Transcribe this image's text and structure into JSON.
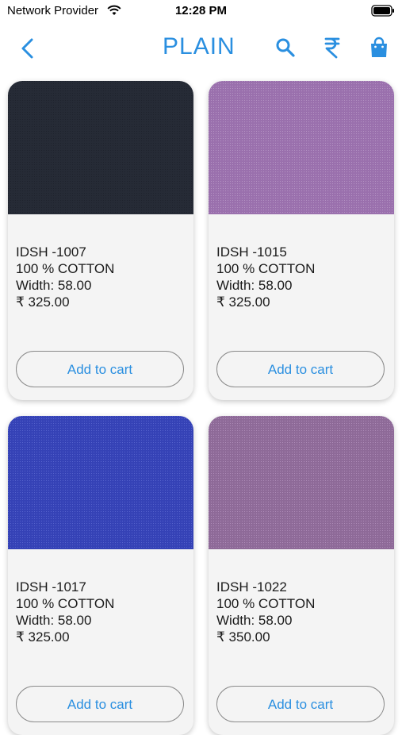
{
  "status_bar": {
    "carrier": "Network Provider",
    "time": "12:28 PM"
  },
  "nav": {
    "title": "PLAIN",
    "icons": [
      "back-chevron-icon",
      "search-icon",
      "rupee-icon",
      "shopping-bag-icon"
    ]
  },
  "colors": {
    "accent": "#2a8fe0",
    "card_bg": "#f4f4f4"
  },
  "products": [
    {
      "code": "IDSH -1007",
      "material": "100 % COTTON",
      "width": "Width: 58.00",
      "price": "₹ 325.00",
      "cta": "Add to cart",
      "swatch_color": "#262b36"
    },
    {
      "code": "IDSH -1015",
      "material": "100 % COTTON",
      "width": "Width: 58.00",
      "price": "₹ 325.00",
      "cta": "Add to cart",
      "swatch_color": "#9a70ad"
    },
    {
      "code": "IDSH -1017",
      "material": "100 % COTTON",
      "width": "Width: 58.00",
      "price": "₹ 325.00",
      "cta": "Add to cart",
      "swatch_color": "#3542b6"
    },
    {
      "code": "IDSH -1022",
      "material": "100 % COTTON",
      "width": "Width: 58.00",
      "price": "₹ 350.00",
      "cta": "Add to cart",
      "swatch_color": "#8e6a98"
    }
  ]
}
